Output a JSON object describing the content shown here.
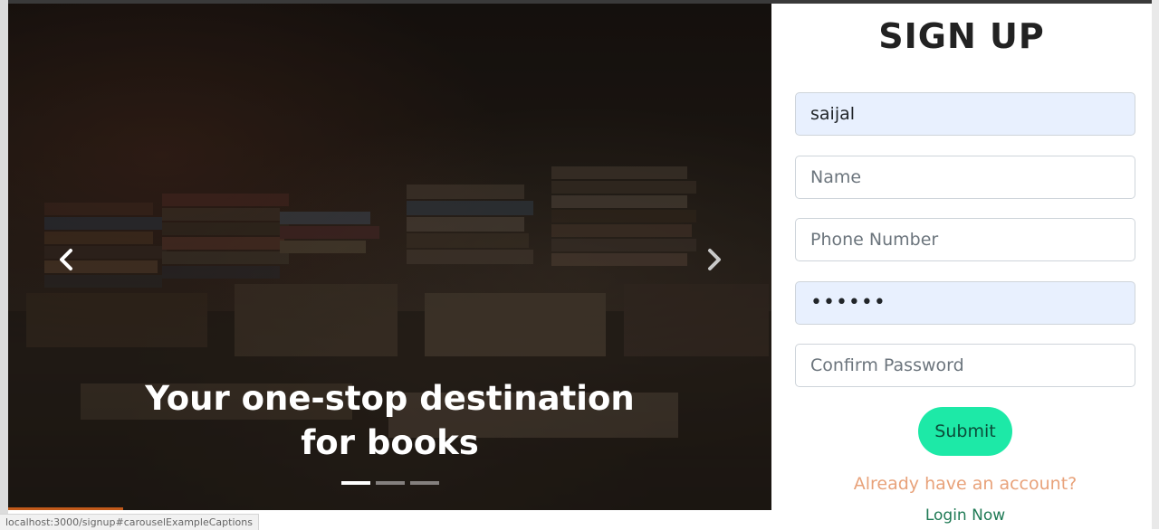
{
  "carousel": {
    "caption": "Your one-stop destination for books",
    "prev_icon": "chevron-left-icon",
    "next_icon": "chevron-right-icon",
    "indicators": [
      true,
      false,
      false
    ]
  },
  "signup": {
    "title": "SIGN UP",
    "username_value": "saijal",
    "name_placeholder": "Name",
    "phone_placeholder": "Phone Number",
    "password_value": "••••••",
    "confirm_placeholder": "Confirm Password",
    "submit_label": "Submit",
    "already_text": "Already have an account?",
    "login_link": "Login Now"
  },
  "status": {
    "url": "localhost:3000/signup#carouselExampleCaptions"
  },
  "colors": {
    "submit_bg": "#1de9a7",
    "already": "#e8a27a",
    "login": "#1f7a55",
    "autofill": "#e8f0fe"
  }
}
